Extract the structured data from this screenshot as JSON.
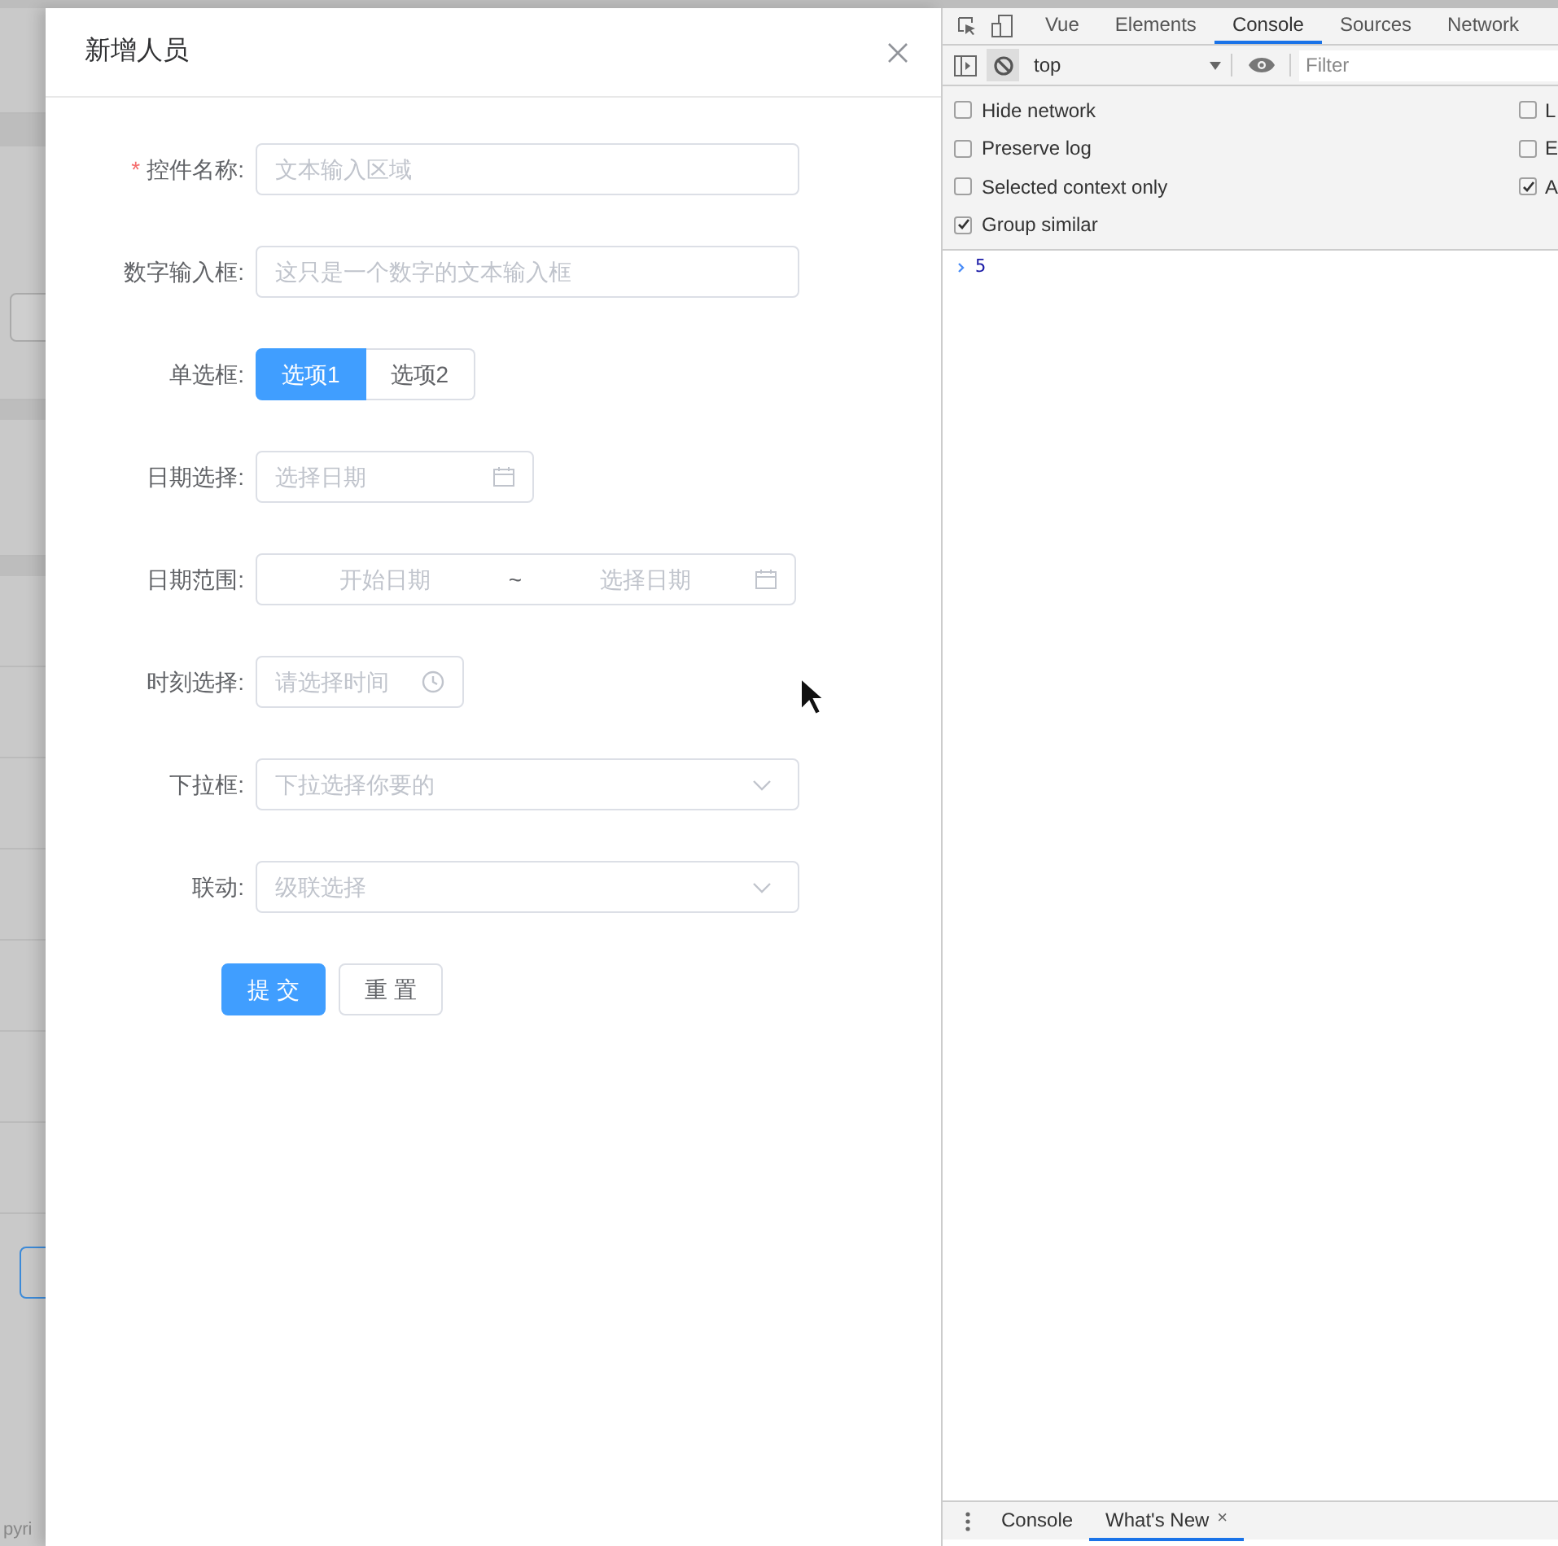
{
  "background": {
    "footer_text": "pyri"
  },
  "drawer": {
    "title": "新增人员",
    "required_mark": "*",
    "fields": [
      {
        "kind": "text",
        "label": "控件名称:",
        "required": true,
        "placeholder": "文本输入区域"
      },
      {
        "kind": "text",
        "label": "数字输入框:",
        "required": false,
        "placeholder": "这只是一个数字的文本输入框"
      },
      {
        "kind": "radio",
        "label": "单选框:",
        "required": false,
        "options": [
          {
            "label": "选项1",
            "selected": true
          },
          {
            "label": "选项2",
            "selected": false
          }
        ]
      },
      {
        "kind": "date",
        "label": "日期选择:",
        "required": false,
        "placeholder": "选择日期"
      },
      {
        "kind": "daterange",
        "label": "日期范围:",
        "required": false,
        "start_placeholder": "开始日期",
        "separator": "~",
        "end_placeholder": "选择日期"
      },
      {
        "kind": "time",
        "label": "时刻选择:",
        "required": false,
        "placeholder": "请选择时间"
      },
      {
        "kind": "select",
        "label": "下拉框:",
        "required": false,
        "placeholder": "下拉选择你要的"
      },
      {
        "kind": "select",
        "label": "联动:",
        "required": false,
        "placeholder": "级联选择"
      }
    ],
    "buttons": [
      {
        "label": "提 交",
        "primary": true
      },
      {
        "label": "重 置",
        "primary": false
      }
    ]
  },
  "devtools": {
    "tabs": [
      {
        "label": "Vue",
        "selected": false
      },
      {
        "label": "Elements",
        "selected": false
      },
      {
        "label": "Console",
        "selected": true
      },
      {
        "label": "Sources",
        "selected": false
      },
      {
        "label": "Network",
        "selected": false
      }
    ],
    "context": "top",
    "filter_placeholder": "Filter",
    "settings_left": [
      {
        "label": "Hide network",
        "checked": false
      },
      {
        "label": "Preserve log",
        "checked": false
      },
      {
        "label": "Selected context only",
        "checked": false
      },
      {
        "label": "Group similar",
        "checked": true
      }
    ],
    "settings_right": [
      {
        "label": "L",
        "checked": false
      },
      {
        "label": "E",
        "checked": false
      },
      {
        "label": "A",
        "checked": true
      }
    ],
    "console_lines": [
      "5"
    ],
    "drawer_tabs": [
      {
        "label": "Console",
        "selected": false,
        "closable": false
      },
      {
        "label": "What's New",
        "selected": true,
        "closable": true
      }
    ],
    "close_glyph": "×"
  }
}
